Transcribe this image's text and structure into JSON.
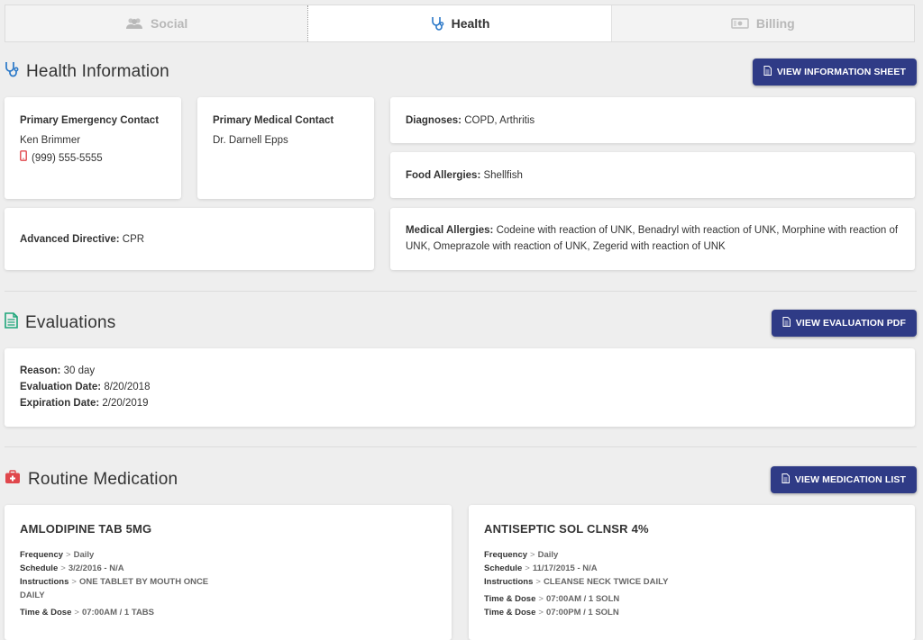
{
  "tabs": [
    {
      "label": "Social",
      "icon": "users-icon"
    },
    {
      "label": "Health",
      "icon": "stethoscope-icon"
    },
    {
      "label": "Billing",
      "icon": "money-icon"
    }
  ],
  "health": {
    "title": "Health Information",
    "button": "VIEW INFORMATION SHEET",
    "emergency": {
      "label": "Primary Emergency Contact",
      "name": "Ken Brimmer",
      "phone": "(999) 555-5555"
    },
    "medical": {
      "label": "Primary Medical Contact",
      "name": "Dr. Darnell Epps"
    },
    "directive": {
      "label": "Advanced Directive:",
      "value": "CPR"
    },
    "diagnoses": {
      "label": "Diagnoses:",
      "value": "COPD, Arthritis"
    },
    "food_allergies": {
      "label": "Food Allergies:",
      "value": "Shellfish"
    },
    "medical_allergies": {
      "label": "Medical Allergies:",
      "value": "Codeine with reaction of UNK, Benadryl with reaction of UNK, Morphine with reaction of UNK, Omeprazole with reaction of UNK, Zegerid with reaction of UNK"
    }
  },
  "evaluations": {
    "title": "Evaluations",
    "button": "VIEW EVALUATION PDF",
    "reason": {
      "label": "Reason:",
      "value": "30 day"
    },
    "eval_date": {
      "label": "Evaluation Date:",
      "value": "8/20/2018"
    },
    "exp_date": {
      "label": "Expiration Date:",
      "value": "2/20/2019"
    }
  },
  "routine": {
    "title": "Routine Medication",
    "button": "VIEW MEDICATION LIST",
    "meds": [
      {
        "name": "AMLODIPINE TAB 5MG",
        "frequency": {
          "k": "Frequency",
          "v": "Daily"
        },
        "schedule": {
          "k": "Schedule",
          "v": "3/2/2016 - N/A"
        },
        "instructions": {
          "k": "Instructions",
          "v": "ONE TABLET BY MOUTH ONCE",
          "v2": "DAILY"
        },
        "doses": [
          {
            "k": "Time & Dose",
            "v": "07:00AM / 1 TABS"
          }
        ]
      },
      {
        "name": "ANTISEPTIC SOL CLNSR 4%",
        "frequency": {
          "k": "Frequency",
          "v": "Daily"
        },
        "schedule": {
          "k": "Schedule",
          "v": "11/17/2015 - N/A"
        },
        "instructions": {
          "k": "Instructions",
          "v": "CLEANSE NECK TWICE DAILY"
        },
        "doses": [
          {
            "k": "Time & Dose",
            "v": "07:00AM / 1 SOLN"
          },
          {
            "k": "Time & Dose",
            "v": "07:00PM / 1 SOLN"
          }
        ]
      }
    ]
  },
  "colors": {
    "accent": "#2f3b86",
    "health_icon": "#2a78c8",
    "eval_icon": "#1ea67a",
    "med_icon": "#e0474c"
  }
}
